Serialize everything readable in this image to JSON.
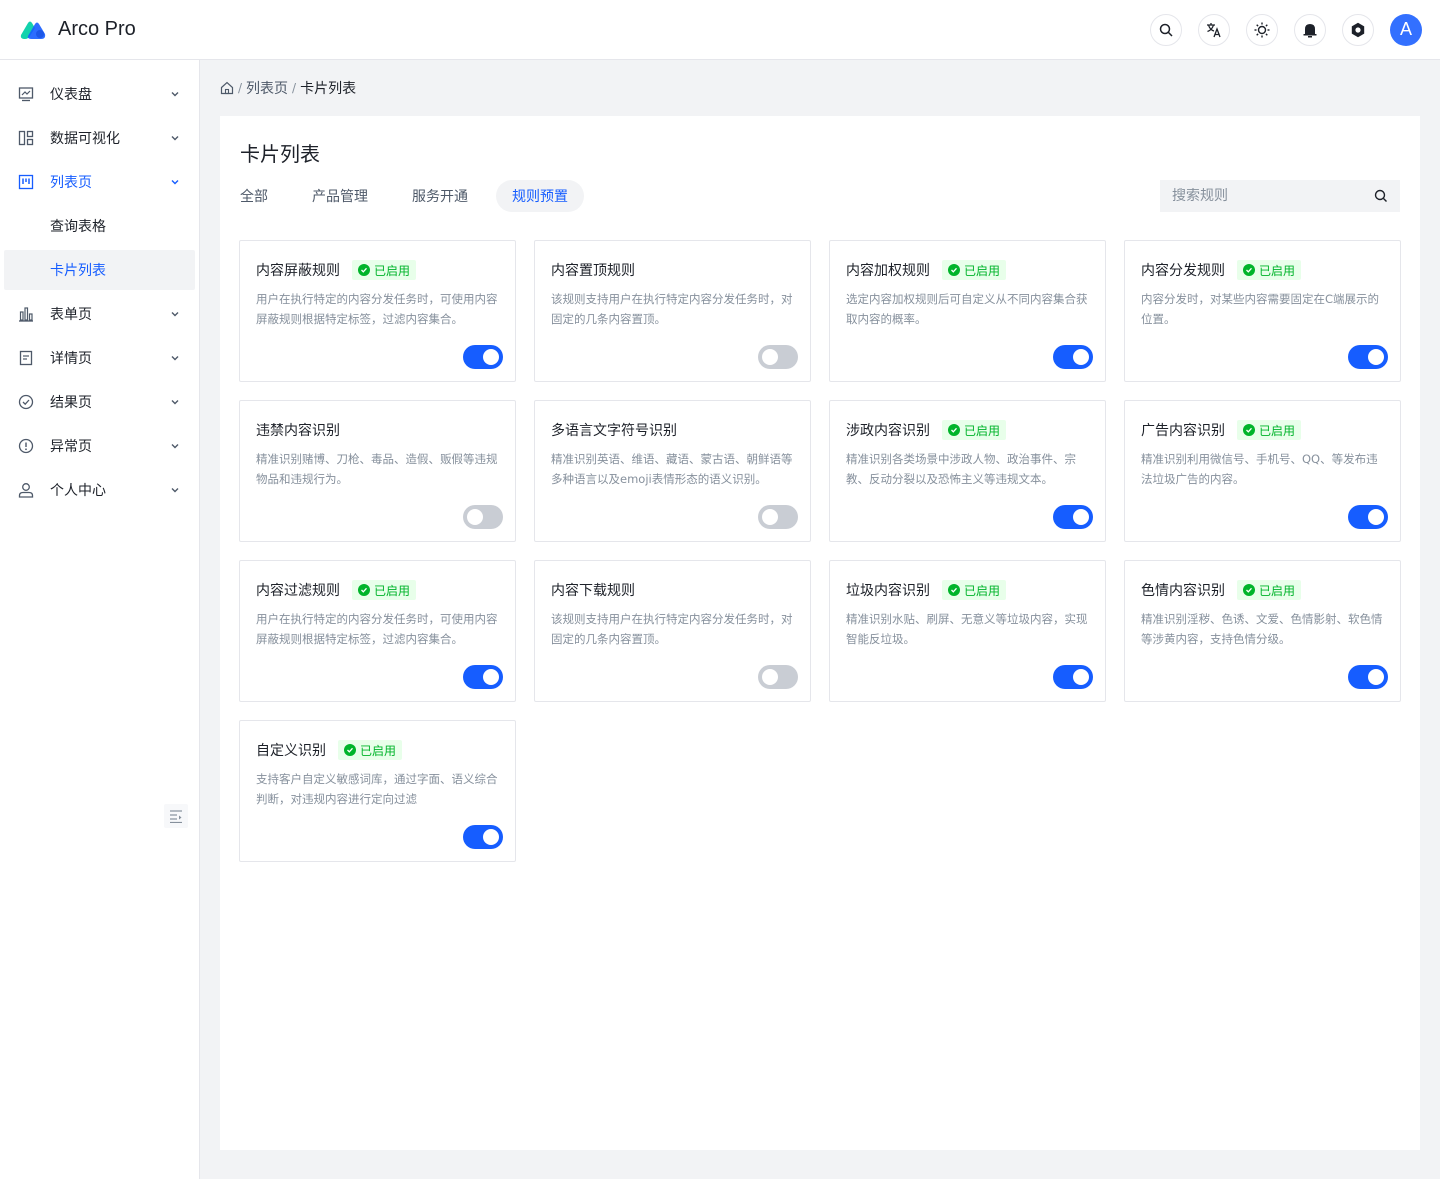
{
  "app": {
    "name": "Arco Pro",
    "avatar_letter": "A"
  },
  "header": {
    "icons": [
      "search-icon",
      "translate-icon",
      "theme-icon",
      "bell-icon",
      "settings-icon"
    ]
  },
  "sidebar": {
    "items": [
      {
        "label": "仪表盘",
        "icon": "dashboard-icon"
      },
      {
        "label": "数据可视化",
        "icon": "visualization-icon"
      },
      {
        "label": "列表页",
        "icon": "list-icon",
        "children": [
          "查询表格",
          "卡片列表"
        ]
      },
      {
        "label": "表单页",
        "icon": "form-icon"
      },
      {
        "label": "详情页",
        "icon": "detail-icon"
      },
      {
        "label": "结果页",
        "icon": "result-icon"
      },
      {
        "label": "异常页",
        "icon": "exception-icon"
      },
      {
        "label": "个人中心",
        "icon": "user-icon"
      }
    ]
  },
  "breadcrumb": {
    "items": [
      "列表页",
      "卡片列表"
    ]
  },
  "page": {
    "title": "卡片列表",
    "tabs": [
      "全部",
      "产品管理",
      "服务开通",
      "规则预置"
    ],
    "active_tab": 3,
    "search_placeholder": "搜索规则"
  },
  "badge_label": "已启用",
  "cards": [
    {
      "title": "内容屏蔽规则",
      "enabled": true,
      "desc": "用户在执行特定的内容分发任务时，可使用内容屏蔽规则根据特定标签，过滤内容集合。"
    },
    {
      "title": "内容置顶规则",
      "enabled": false,
      "desc": "该规则支持用户在执行特定内容分发任务时，对固定的几条内容置顶。"
    },
    {
      "title": "内容加权规则",
      "enabled": true,
      "desc": "选定内容加权规则后可自定义从不同内容集合获取内容的概率。"
    },
    {
      "title": "内容分发规则",
      "enabled": true,
      "desc": "内容分发时，对某些内容需要固定在C端展示的位置。"
    },
    {
      "title": "违禁内容识别",
      "enabled": false,
      "desc": "精准识别赌博、刀枪、毒品、造假、贩假等违规物品和违规行为。"
    },
    {
      "title": "多语言文字符号识别",
      "enabled": false,
      "desc": "精准识别英语、维语、藏语、蒙古语、朝鲜语等多种语言以及emoji表情形态的语义识别。"
    },
    {
      "title": "涉政内容识别",
      "enabled": true,
      "desc": "精准识别各类场景中涉政人物、政治事件、宗教、反动分裂以及恐怖主义等违规文本。"
    },
    {
      "title": "广告内容识别",
      "enabled": true,
      "desc": "精准识别利用微信号、手机号、QQ、等发布违法垃圾广告的内容。"
    },
    {
      "title": "内容过滤规则",
      "enabled": true,
      "desc": "用户在执行特定的内容分发任务时，可使用内容屏蔽规则根据特定标签，过滤内容集合。"
    },
    {
      "title": "内容下载规则",
      "enabled": false,
      "desc": "该规则支持用户在执行特定内容分发任务时，对固定的几条内容置顶。"
    },
    {
      "title": "垃圾内容识别",
      "enabled": true,
      "desc": "精准识别水贴、刷屏、无意义等垃圾内容，实现智能反垃圾。"
    },
    {
      "title": "色情内容识别",
      "enabled": true,
      "desc": "精准识别淫秽、色诱、文爱、色情影射、软色情等涉黄内容，支持色情分级。"
    },
    {
      "title": "自定义识别",
      "enabled": true,
      "desc": "支持客户自定义敏感词库，通过字面、语义综合判断，对违规内容进行定向过滤"
    }
  ],
  "colors": {
    "primary": "#165dff",
    "success": "#00b42a",
    "success_bg": "#e8ffea",
    "switch_off": "#c9cdd4"
  }
}
